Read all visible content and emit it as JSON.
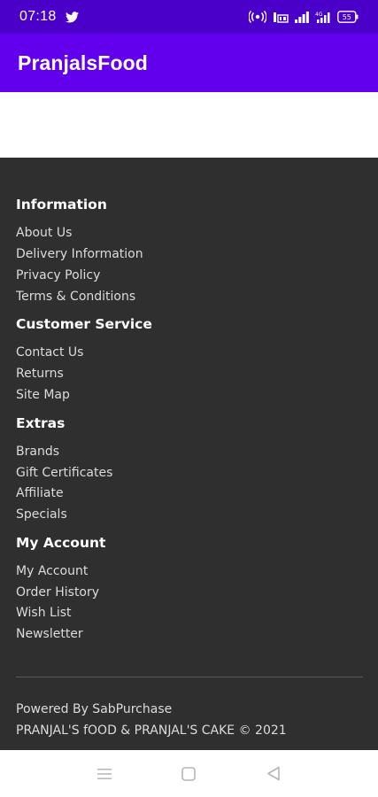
{
  "status_bar": {
    "time": "07:18",
    "icons": [
      "twitter-icon",
      "hotspot-icon",
      "volte-icon",
      "signal-icon",
      "data-signal-icon",
      "battery-icon"
    ],
    "battery_level": "55"
  },
  "app_bar": {
    "title": "PranjalsFood",
    "color": "#6200ee",
    "status_color": "#4a00c8"
  },
  "footer": {
    "background": "#2f2f2f",
    "sections": [
      {
        "title": "Information",
        "links": [
          "About Us",
          "Delivery Information",
          "Privacy Policy",
          "Terms & Conditions"
        ]
      },
      {
        "title": "Customer Service",
        "links": [
          "Contact Us",
          "Returns",
          "Site Map"
        ]
      },
      {
        "title": "Extras",
        "links": [
          "Brands",
          "Gift Certificates",
          "Affiliate",
          "Specials"
        ]
      },
      {
        "title": "My Account",
        "links": [
          "My Account",
          "Order History",
          "Wish List",
          "Newsletter"
        ]
      }
    ],
    "powered_by": "Powered By SabPurchase",
    "copyright": "PRANJAL'S fOOD & PRANJAL'S CAKE © 2021"
  },
  "nav_bar": {
    "icons": [
      "menu-icon",
      "home-icon",
      "back-icon"
    ]
  }
}
